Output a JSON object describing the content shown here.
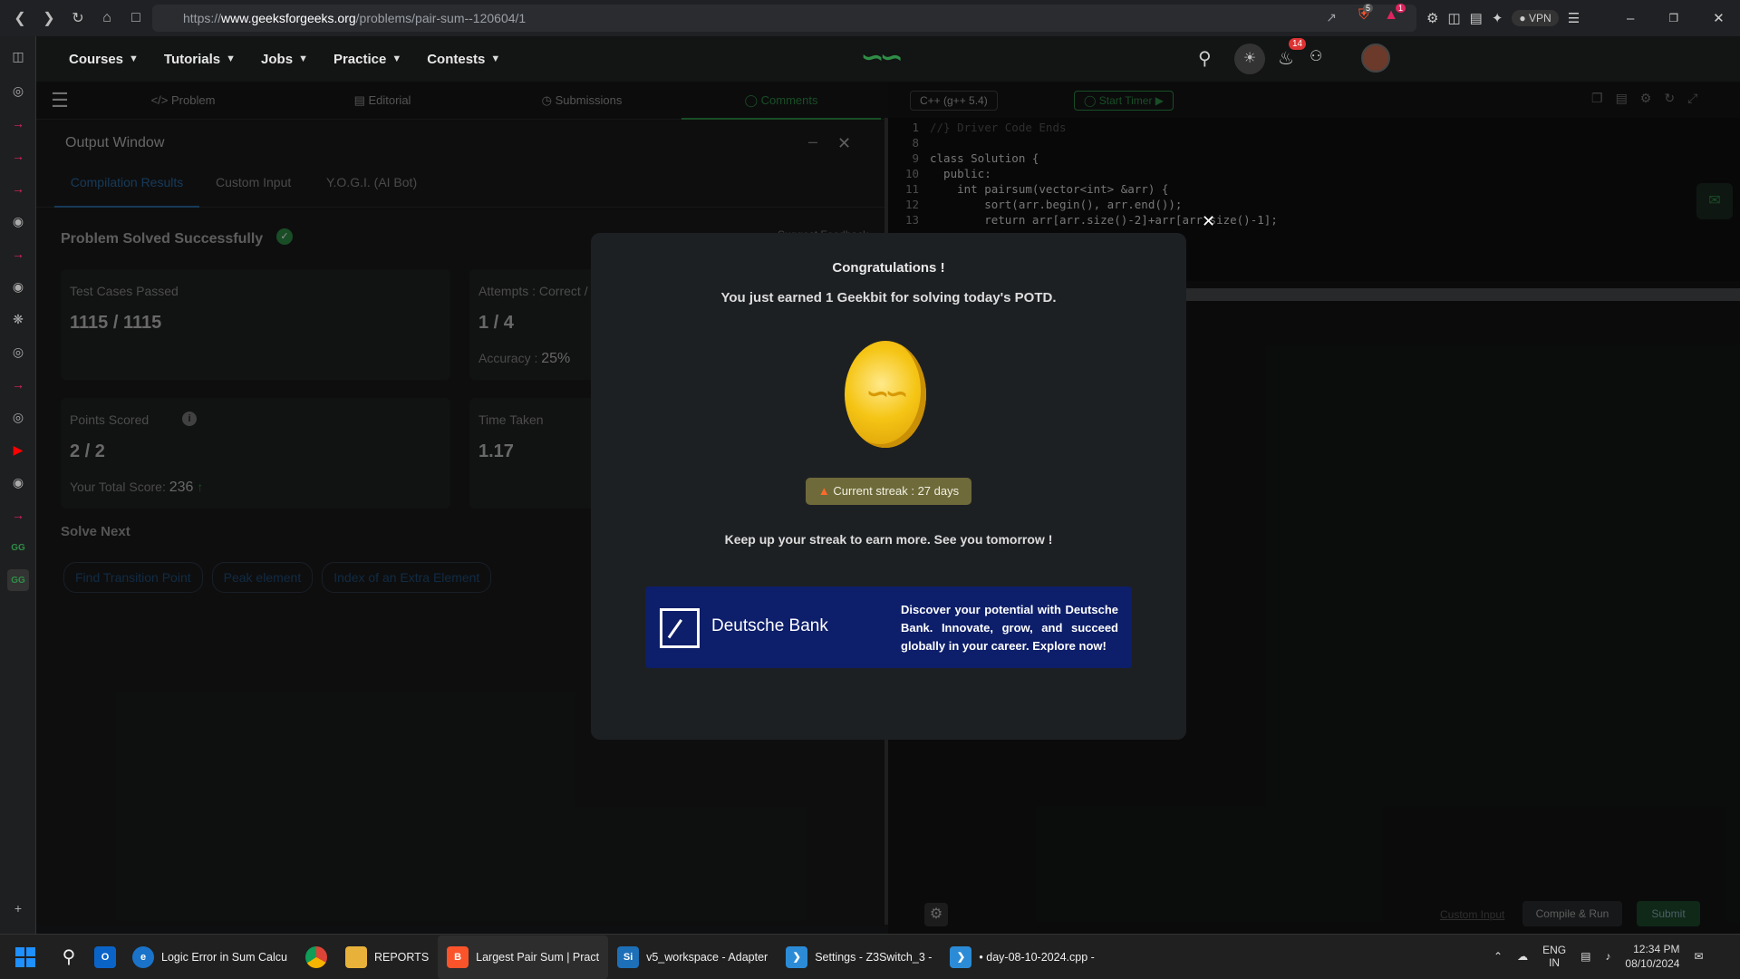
{
  "browser": {
    "url_prefix": "https://",
    "url_host": "www.geeksforgeeks.org",
    "url_path": "/problems/pair-sum--120604/1",
    "vpn_label": "VPN",
    "brave_badge": "5",
    "alert_badge": "1"
  },
  "site": {
    "menu": [
      "Courses",
      "Tutorials",
      "Jobs",
      "Practice",
      "Contests"
    ],
    "notif_count": "14"
  },
  "subtabs": {
    "problem": "Problem",
    "editorial": "Editorial",
    "submissions": "Submissions",
    "comments": "Comments"
  },
  "output": {
    "title": "Output Window",
    "tabs": [
      "Compilation Results",
      "Custom Input",
      "Y.O.G.I. (AI Bot)"
    ],
    "status": "Problem Solved Successfully",
    "feedback": "Suggest Feedback",
    "test_cases_label": "Test Cases Passed",
    "test_cases_value": "1115 / 1115",
    "attempts_label": "Attempts : Correct / Total",
    "attempts_value": "1 / 4",
    "accuracy_label": "Accuracy :",
    "accuracy_value": "25%",
    "points_label": "Points Scored",
    "points_value": "2 / 2",
    "total_score_label": "Your Total Score:",
    "total_score_value": "236",
    "time_label": "Time Taken",
    "time_value": "1.17",
    "solve_next": "Solve Next",
    "next_problems": [
      "Find Transition Point",
      "Peak element",
      "Index of an Extra Element"
    ]
  },
  "editor": {
    "language": "C++ (g++ 5.4)",
    "timer": "Start Timer",
    "lines": [
      {
        "n": "1",
        "text": "//} Driver Code Ends"
      },
      {
        "n": "8",
        "text": ""
      },
      {
        "n": "9",
        "text": "class Solution {"
      },
      {
        "n": "10",
        "text": "  public:"
      },
      {
        "n": "11",
        "text": "    int pairsum(vector<int> &arr) {"
      },
      {
        "n": "12",
        "text": "        sort(arr.begin(), arr.end());"
      },
      {
        "n": "13",
        "text": "        return arr[arr.size()-2]+arr[arr.size()-1];"
      }
    ],
    "custom_input": "Custom Input",
    "compile_run": "Compile & Run",
    "submit": "Submit"
  },
  "modal": {
    "title": "Congratulations !",
    "message": "You just earned 1 Geekbit for solving today's POTD.",
    "streak": "Current streak : 27 days",
    "keep_up": "Keep up your streak to earn more. See you tomorrow !",
    "ad_brand": "Deutsche Bank",
    "ad_text": "Discover your potential with Deutsche Bank. Innovate, grow, and succeed globally in your career. Explore now!"
  },
  "taskbar": {
    "items": [
      {
        "label": "Logic Error in Sum Calcu",
        "icon": "edge-icon",
        "color": "#1a73c9"
      },
      {
        "label": "",
        "icon": "chrome-icon",
        "color": "#db4437"
      },
      {
        "label": "REPORTS",
        "icon": "folder-icon",
        "color": "#e8b23a"
      },
      {
        "label": "Largest Pair Sum | Pract",
        "icon": "brave-icon",
        "color": "#fb542b"
      },
      {
        "label": "v5_workspace - Adapter",
        "icon": "simplicity-icon",
        "color": "#1d6fb8"
      },
      {
        "label": "Settings - Z3Switch_3 -",
        "icon": "vscode-icon",
        "color": "#2c8bd6"
      },
      {
        "label": "• day-08-10-2024.cpp -",
        "icon": "vscode-icon",
        "color": "#2c8bd6"
      }
    ],
    "lang_top": "ENG",
    "lang_bottom": "IN",
    "time": "12:34 PM",
    "date": "08/10/2024"
  }
}
